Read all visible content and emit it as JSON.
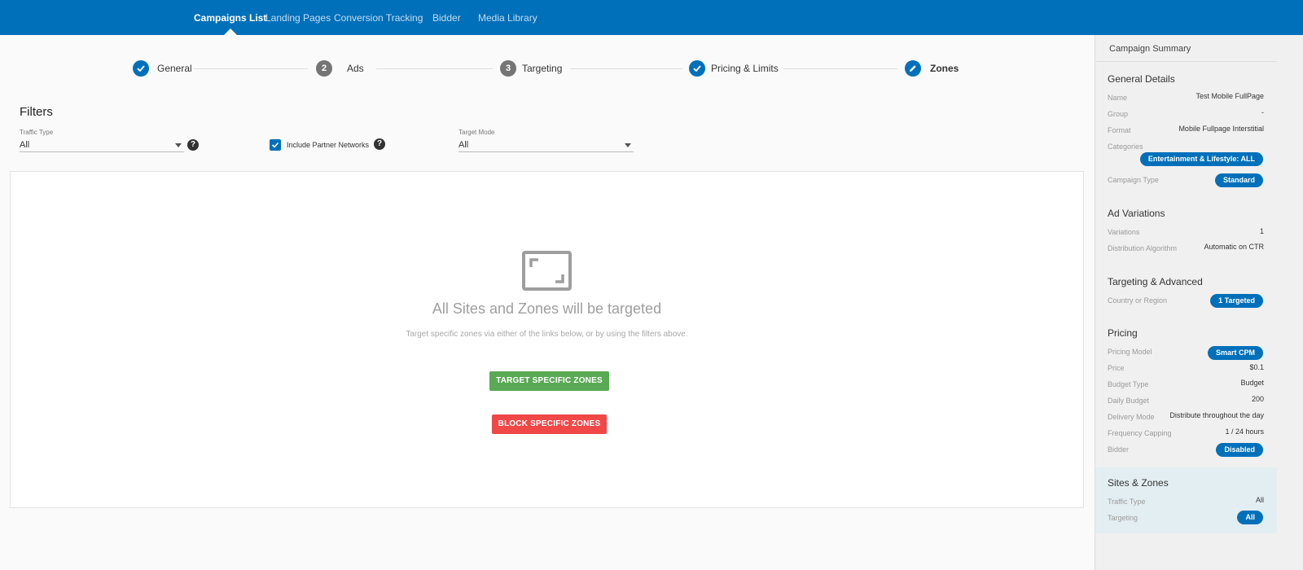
{
  "nav": {
    "items": [
      "Campaigns List",
      "Landing Pages",
      "Conversion Tracking",
      "Bidder",
      "Media Library"
    ],
    "active": "Campaigns List"
  },
  "stepper": {
    "steps": [
      {
        "label": "General",
        "state": "done",
        "marker": ""
      },
      {
        "label": "Ads",
        "state": "number",
        "marker": "2"
      },
      {
        "label": "Targeting",
        "state": "number",
        "marker": "3"
      },
      {
        "label": "Pricing & Limits",
        "state": "done",
        "marker": ""
      },
      {
        "label": "Zones",
        "state": "current",
        "marker": ""
      }
    ]
  },
  "filters": {
    "title": "Filters",
    "traffic_type": {
      "label": "Traffic Type",
      "value": "All"
    },
    "partner_networks": {
      "label": "Include Partner Networks",
      "checked": true
    },
    "target_mode": {
      "label": "Target Mode",
      "value": "All"
    },
    "help_glyph": "?"
  },
  "empty_state": {
    "title": "All Sites and Zones will be targeted",
    "subtitle": "Target specific zones via either of the links below, or by using the filters above.",
    "target_button": "TARGET SPECIFIC ZONES",
    "block_button": "BLOCK SPECIFIC ZONES"
  },
  "summary": {
    "title": "Campaign Summary",
    "general": {
      "heading": "General Details",
      "name_key": "Name",
      "name_val": "Test Mobile FullPage",
      "group_key": "Group",
      "group_val": "-",
      "format_key": "Format",
      "format_val": "Mobile Fullpage Interstitial",
      "categories_key": "Categories",
      "categories_val": "Entertainment & Lifestyle: ALL",
      "type_key": "Campaign Type",
      "type_val": "Standard"
    },
    "ads": {
      "heading": "Ad Variations",
      "variations_key": "Variations",
      "variations_val": "1",
      "algo_key": "Distribution Algorithm",
      "algo_val": "Automatic on CTR"
    },
    "targeting": {
      "heading": "Targeting & Advanced",
      "country_key": "Country or Region",
      "country_val": "1 Targeted"
    },
    "pricing": {
      "heading": "Pricing",
      "model_key": "Pricing Model",
      "model_val": "Smart CPM",
      "price_key": "Price",
      "price_val": "$0.1",
      "budget_type_key": "Budget Type",
      "budget_type_val": "Budget",
      "daily_key": "Daily Budget",
      "daily_val": "200",
      "delivery_key": "Delivery Mode",
      "delivery_val": "Distribute throughout the day",
      "freq_key": "Frequency Capping",
      "freq_val": "1 / 24 hours",
      "bidder_key": "Bidder",
      "bidder_val": "Disabled"
    },
    "sites": {
      "heading": "Sites & Zones",
      "traffic_key": "Traffic Type",
      "traffic_val": "All",
      "targeting_key": "Targeting",
      "targeting_val": "All"
    }
  },
  "colors": {
    "brand": "#0070ba",
    "green": "#5aa954",
    "red": "#f04747"
  }
}
